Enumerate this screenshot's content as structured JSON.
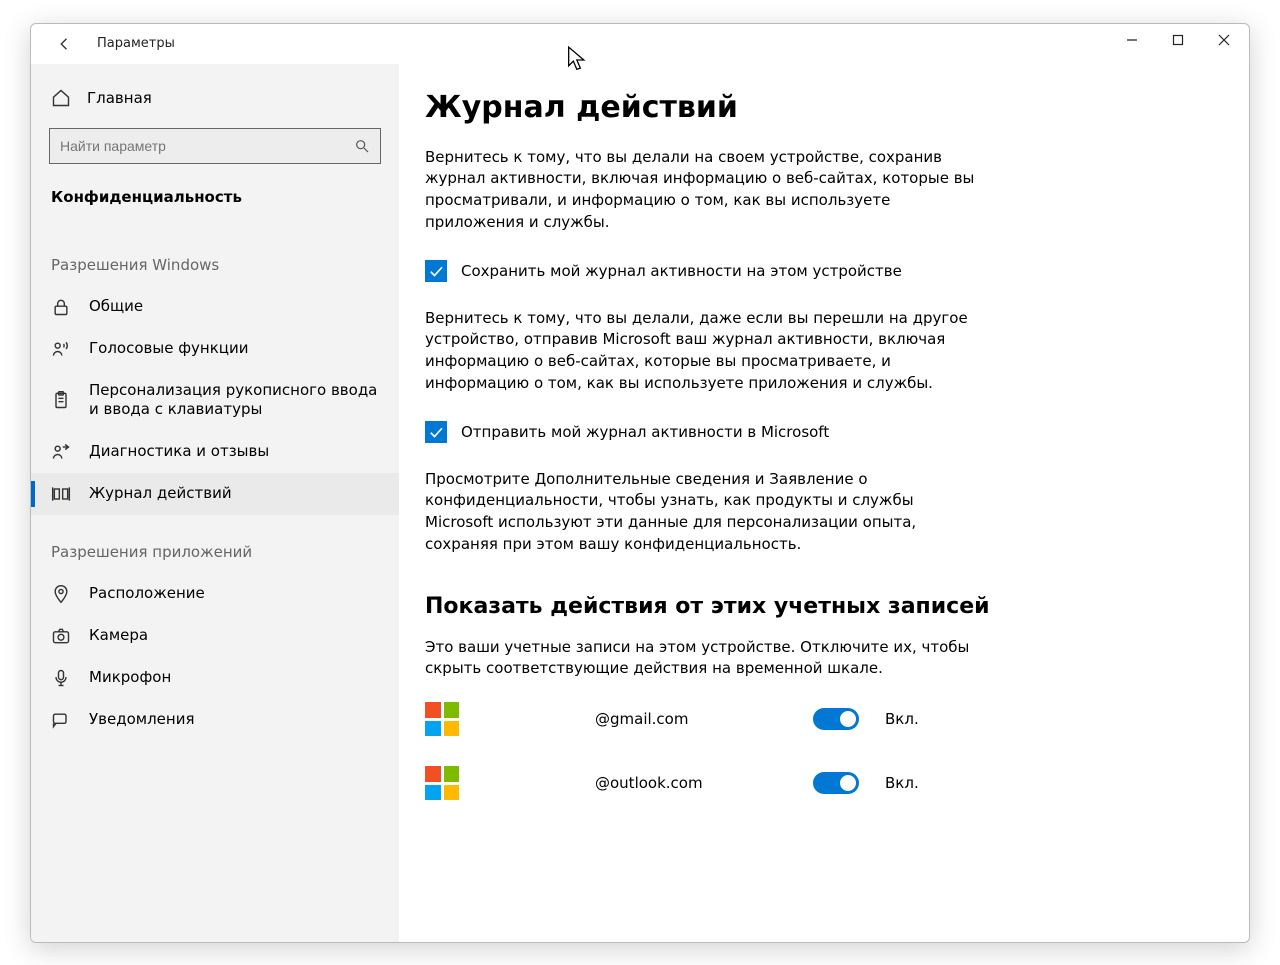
{
  "window": {
    "title": "Параметры"
  },
  "sidebar": {
    "home_label": "Главная",
    "search_placeholder": "Найти параметр",
    "current_section": "Конфиденциальность",
    "group1_title": "Разрешения Windows",
    "group1": [
      {
        "label": "Общие"
      },
      {
        "label": "Голосовые функции"
      },
      {
        "label": "Персонализация рукописного ввода и ввода с клавиатуры"
      },
      {
        "label": "Диагностика и отзывы"
      },
      {
        "label": "Журнал действий"
      }
    ],
    "group2_title": "Разрешения приложений",
    "group2": [
      {
        "label": "Расположение"
      },
      {
        "label": "Камера"
      },
      {
        "label": "Микрофон"
      },
      {
        "label": "Уведомления"
      }
    ]
  },
  "content": {
    "title": "Журнал действий",
    "para1": "Вернитесь к тому, что вы делали на своем устройстве, сохранив журнал активности, включая информацию о веб-сайтах, которые вы просматривали, и информацию о том, как вы используете приложения и службы.",
    "check1_label": "Сохранить мой журнал активности на этом устройстве",
    "para2": "Вернитесь к тому, что вы делали, даже если вы перешли на другое устройство, отправив Microsoft ваш журнал активности, включая информацию о веб-сайтах, которые вы просматриваете, и информацию о том, как вы используете приложения и службы.",
    "check2_label": "Отправить мой журнал активности в Microsoft",
    "para3": "Просмотрите Дополнительные сведения и Заявление о конфиденциальности, чтобы узнать, как продукты и службы Microsoft используют эти данные для персонализации опыта, сохраняя при этом вашу конфиденциальность.",
    "accounts_heading": "Показать действия от этих учетных записей",
    "accounts_sub": "Это ваши учетные записи на этом устройстве. Отключите их, чтобы скрыть соответствующие действия на временной шкале.",
    "accounts": [
      {
        "name": "@gmail.com",
        "state": "Вкл."
      },
      {
        "name": "@outlook.com",
        "state": "Вкл."
      }
    ]
  }
}
